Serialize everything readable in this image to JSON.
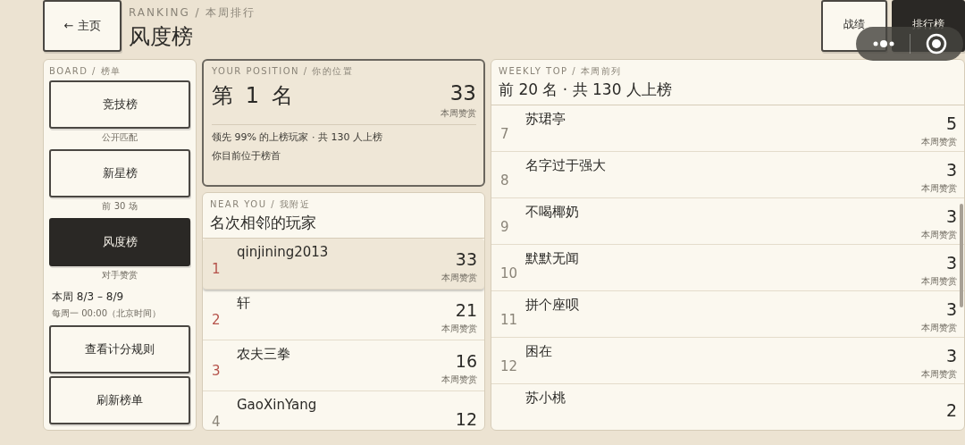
{
  "header": {
    "back_button": "← 主页",
    "eyebrow": "RANKING / 本周排行",
    "title": "风度榜",
    "tabs": [
      {
        "label": "战绩",
        "selected": false
      },
      {
        "label": "排行榜",
        "selected": true
      }
    ]
  },
  "board": {
    "eyebrow": "BOARD / 榜单",
    "items": [
      {
        "label": "竞技榜",
        "caption": "公开匹配",
        "selected": false
      },
      {
        "label": "新星榜",
        "caption": "前 30 场",
        "selected": false
      },
      {
        "label": "风度榜",
        "caption": "对手赞赏",
        "selected": true
      }
    ],
    "week": "本周 8/3 – 8/9",
    "reset": "每周一 00:00（北京时间）",
    "buttons": [
      "查看计分规则",
      "刷新榜单"
    ]
  },
  "position": {
    "eyebrow": "YOUR POSITION / 你的位置",
    "rank": "第 1 名",
    "score": "33",
    "score_label": "本周赞赏",
    "lead": "领先 99% 的上榜玩家 · 共 130 人上榜",
    "note": "你目前位于榜首"
  },
  "near_you": {
    "eyebrow": "NEAR YOU / 我附近",
    "title": "名次相邻的玩家",
    "rows": [
      {
        "rank": "1",
        "name": "qinjining2013",
        "score": "33",
        "label": "本周赞赏",
        "selected": true,
        "color": "#b5524a"
      },
      {
        "rank": "2",
        "name": "轩",
        "score": "21",
        "label": "本周赞赏",
        "selected": false,
        "color": "#b5524a"
      },
      {
        "rank": "3",
        "name": "农夫三拳",
        "score": "16",
        "label": "本周赞赏",
        "selected": false,
        "color": "#b5524a"
      },
      {
        "rank": "4",
        "name": "GaoXinYang",
        "score": "12",
        "selected": false,
        "color": "#8a8478"
      }
    ]
  },
  "weekly_top": {
    "eyebrow": "WEEKLY TOP / 本周前列",
    "title": "前 20 名 · 共 130 人上榜",
    "rows": [
      {
        "rank": "7",
        "name": "苏珺亭",
        "score": "5",
        "label": "本周赞赏"
      },
      {
        "rank": "8",
        "name": "名字过于强大",
        "score": "3",
        "label": "本周赞赏"
      },
      {
        "rank": "9",
        "name": "不喝椰奶",
        "score": "3",
        "label": "本周赞赏"
      },
      {
        "rank": "10",
        "name": "默默无闻",
        "score": "3",
        "label": "本周赞赏"
      },
      {
        "rank": "11",
        "name": "拼个座呗",
        "score": "3",
        "label": "本周赞赏"
      },
      {
        "rank": "12",
        "name": "困在",
        "score": "3",
        "label": "本周赞赏"
      },
      {
        "name": "苏小桃",
        "score": "2"
      }
    ]
  }
}
